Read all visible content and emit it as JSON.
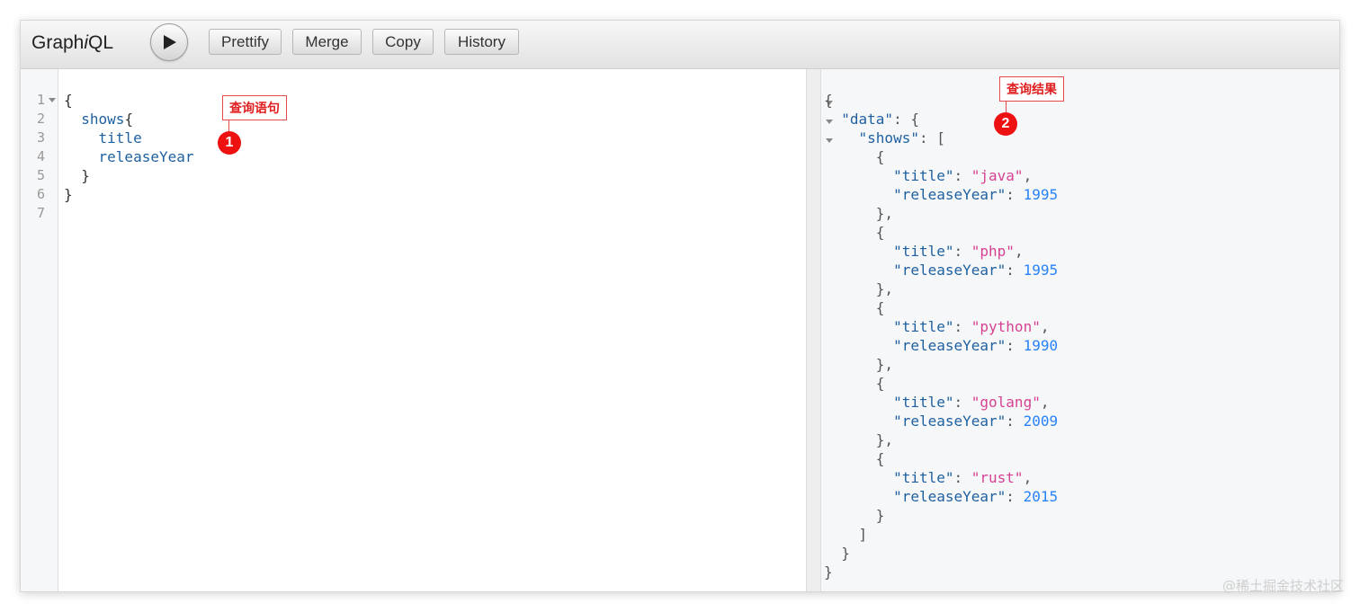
{
  "app": {
    "title_prefix": "Graph",
    "title_italic": "i",
    "title_suffix": "QL"
  },
  "toolbar": {
    "execute_icon": "play-icon",
    "buttons": [
      "Prettify",
      "Merge",
      "Copy",
      "History"
    ]
  },
  "query_editor": {
    "line_numbers": [
      "1",
      "2",
      "3",
      "4",
      "5",
      "6",
      "7"
    ],
    "lines": [
      {
        "text": "{",
        "cls": "kw-def"
      },
      {
        "text": "  shows{",
        "field": "shows",
        "indent": "  ",
        "brace": "{"
      },
      {
        "text": "    title",
        "field": "title",
        "indent": "    "
      },
      {
        "text": "    releaseYear",
        "field": "releaseYear",
        "indent": "    "
      },
      {
        "text": "  }",
        "cls": "kw-def"
      },
      {
        "text": "}",
        "cls": "kw-def"
      },
      {
        "text": "",
        "cls": "kw-def"
      }
    ]
  },
  "result_viewer": {
    "json": {
      "data": {
        "shows": [
          {
            "title": "java",
            "releaseYear": 1995
          },
          {
            "title": "php",
            "releaseYear": 1995
          },
          {
            "title": "python",
            "releaseYear": 1990
          },
          {
            "title": "golang",
            "releaseYear": 2009
          },
          {
            "title": "rust",
            "releaseYear": 2015
          }
        ]
      }
    }
  },
  "annotations": {
    "query_label": "查询语句",
    "query_badge": "1",
    "result_label": "查询结果",
    "result_badge": "2"
  },
  "watermark": "@稀土掘金技术社区",
  "colors": {
    "field": "#1f61a0",
    "string": "#d64292",
    "number": "#2882f9",
    "annotation": "#e84a4a"
  }
}
